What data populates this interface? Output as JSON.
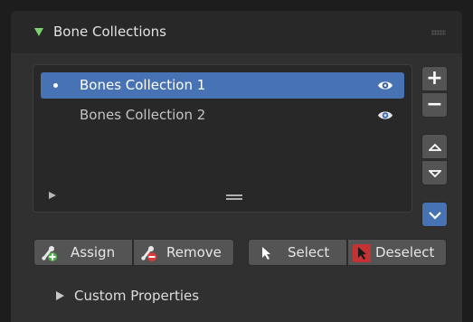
{
  "panel": {
    "title": "Bone Collections",
    "expand_icon": "disclosure-triangle-down-icon"
  },
  "collections": [
    {
      "name": "Bones Collection 1",
      "active": true,
      "visible": true
    },
    {
      "name": "Bones Collection 2",
      "active": false,
      "visible": true
    }
  ],
  "side_buttons": {
    "add": "+",
    "remove": "−",
    "move_up": "move-up-icon",
    "move_down": "move-down-icon",
    "specials": "chevron-down-icon"
  },
  "actions": {
    "assign": "Assign",
    "remove": "Remove",
    "select": "Select",
    "deselect": "Deselect"
  },
  "custom_properties": "Custom Properties",
  "colors": {
    "accent": "#4772b3",
    "triangle": "#7bd36d",
    "panel_bg": "#303030"
  }
}
